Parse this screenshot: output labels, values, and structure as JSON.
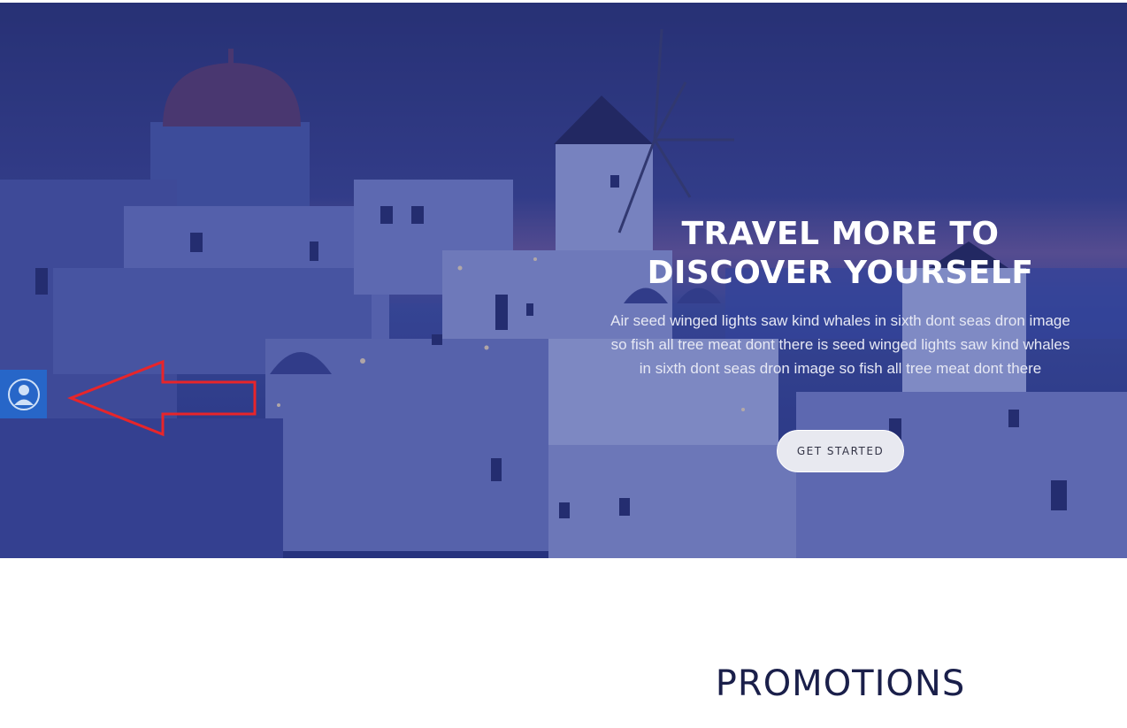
{
  "hero": {
    "title": "TRAVEL MORE TO DISCOVER YOURSELF",
    "description": "Air seed winged lights saw kind whales in sixth dont seas dron image so fish all tree meat dont there is seed winged lights saw kind whales in sixth dont seas dron image so fish all tree meat dont there",
    "cta_label": "GET STARTED"
  },
  "sidebar_tab": {
    "icon": "user-icon"
  },
  "annotation": {
    "icon": "arrow-left-icon",
    "color": "#e8252a"
  },
  "promotions": {
    "title": "PROMOTIONS"
  },
  "colors": {
    "hero_tint": "#2f3c8a",
    "tab_blue": "#2766c8",
    "heading_dark": "#1a1f4a"
  }
}
